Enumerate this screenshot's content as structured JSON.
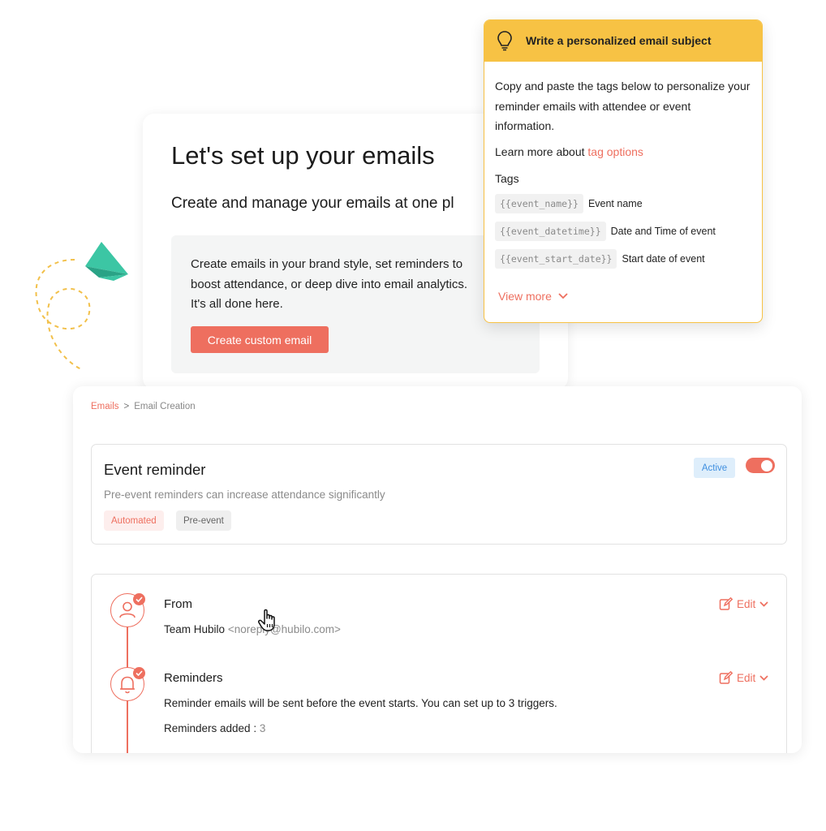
{
  "setup": {
    "title": "Let's set up your emails",
    "subtitle": "Create and manage your emails at one pl",
    "description": "Create emails in your brand style, set reminders to boost attendance, or deep dive into email analytics. It's all done here.",
    "create_button": "Create custom email"
  },
  "tooltip": {
    "title": "Write a personalized email subject",
    "body": "Copy and paste the tags below to personalize your reminder emails with attendee or event information.",
    "learn_prefix": "Learn more about ",
    "learn_link": "tag options",
    "tags_label": "Tags",
    "tags": [
      {
        "code": "{{event_name}}",
        "label": "Event name"
      },
      {
        "code": "{{event_datetime}}",
        "label": "Date and Time of event"
      },
      {
        "code": "{{event_start_date}}",
        "label": "Start date of event"
      }
    ],
    "view_more": "View more"
  },
  "breadcrumb": {
    "root": "Emails",
    "separator": ">",
    "current": "Email Creation"
  },
  "reminder": {
    "title": "Event reminder",
    "description": "Pre-event reminders can increase attendance significantly",
    "chips": [
      "Automated",
      "Pre-event"
    ],
    "status": "Active",
    "toggle_on": true
  },
  "steps": {
    "from": {
      "title": "From",
      "sender_name": "Team Hubilo",
      "sender_email": "<noreply@hubilo.com>",
      "edit": "Edit"
    },
    "reminders": {
      "title": "Reminders",
      "text": "Reminder emails will be sent before the event starts. You can set up to 3 triggers.",
      "added_label": "Reminders added : ",
      "added_count": "3",
      "edit": "Edit"
    }
  },
  "colors": {
    "accent": "#ee6f5f",
    "tooltip_header": "#f7c244",
    "active_badge_bg": "#deeefb",
    "active_badge_text": "#3f8fe0",
    "plane": "#3cc6a4"
  },
  "icons": [
    "paper-plane-icon",
    "lightbulb-icon",
    "chevron-down-icon",
    "user-icon",
    "bell-icon",
    "check-icon",
    "edit-icon",
    "hand-cursor-icon"
  ]
}
